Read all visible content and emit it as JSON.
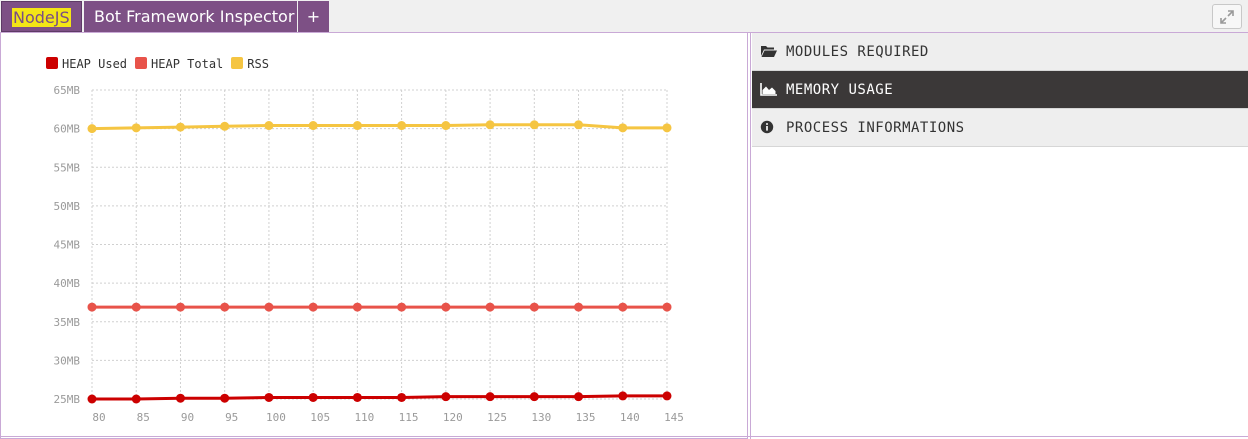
{
  "tabs": {
    "nodejs": "NodeJS",
    "bot": "Bot Framework Inspector",
    "add": "+"
  },
  "sidebar": {
    "items": [
      {
        "label": "MODULES REQUIRED",
        "icon": "folder-open-icon",
        "active": false
      },
      {
        "label": "MEMORY USAGE",
        "icon": "area-chart-icon",
        "active": true
      },
      {
        "label": "PROCESS INFORMATIONS",
        "icon": "info-circle-icon",
        "active": false
      }
    ]
  },
  "chart_data": {
    "type": "line",
    "x": [
      80,
      85,
      90,
      95,
      100,
      105,
      110,
      115,
      120,
      125,
      130,
      135,
      140,
      145
    ],
    "xtick_labels": [
      "80",
      "85",
      "90",
      "95",
      "100",
      "105",
      "110",
      "115",
      "120",
      "125",
      "130",
      "135",
      "140",
      "145"
    ],
    "ytick_values": [
      25,
      30,
      35,
      40,
      45,
      50,
      55,
      60,
      65
    ],
    "ytick_labels": [
      "25MB",
      "30MB",
      "35MB",
      "40MB",
      "45MB",
      "50MB",
      "55MB",
      "60MB",
      "65MB"
    ],
    "ylim": [
      25,
      65
    ],
    "grid": true,
    "legend_position": "top-left",
    "series": [
      {
        "name": "HEAP Used",
        "color": "#cc0000",
        "values": [
          25.0,
          25.0,
          25.1,
          25.1,
          25.2,
          25.2,
          25.2,
          25.2,
          25.3,
          25.3,
          25.3,
          25.3,
          25.4,
          25.4
        ]
      },
      {
        "name": "HEAP Total",
        "color": "#e8534a",
        "values": [
          36.9,
          36.9,
          36.9,
          36.9,
          36.9,
          36.9,
          36.9,
          36.9,
          36.9,
          36.9,
          36.9,
          36.9,
          36.9,
          36.9
        ]
      },
      {
        "name": "RSS",
        "color": "#f5c542",
        "values": [
          60.0,
          60.1,
          60.2,
          60.3,
          60.4,
          60.4,
          60.4,
          60.4,
          60.4,
          60.5,
          60.5,
          60.5,
          60.1,
          60.1
        ]
      }
    ]
  }
}
